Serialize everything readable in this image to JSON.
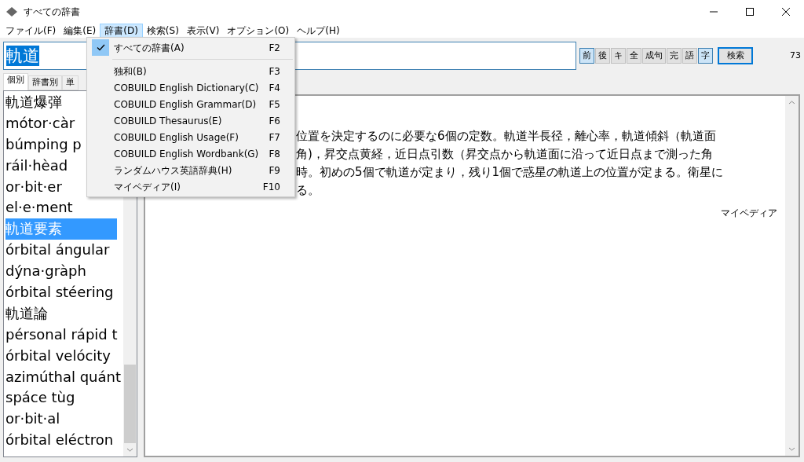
{
  "window": {
    "title": "すべての辞書"
  },
  "menubar": [
    {
      "label": "ファイル(F)",
      "selected": false
    },
    {
      "label": "編集(E)",
      "selected": false
    },
    {
      "label": "辞書(D)",
      "selected": true
    },
    {
      "label": "検索(S)",
      "selected": false
    },
    {
      "label": "表示(V)",
      "selected": false
    },
    {
      "label": "オプション(O)",
      "selected": false
    },
    {
      "label": "ヘルプ(H)",
      "selected": false
    }
  ],
  "search": {
    "value": "軌道"
  },
  "toggles": [
    {
      "label": "前",
      "selected": true
    },
    {
      "label": "後",
      "selected": false
    },
    {
      "label": "キ",
      "selected": false
    },
    {
      "label": "全",
      "selected": false
    },
    {
      "label": "成句",
      "selected": false
    },
    {
      "label": "完",
      "selected": false
    },
    {
      "label": "語",
      "selected": false
    },
    {
      "label": "字",
      "selected": true
    }
  ],
  "search_button": "検索",
  "count": "73",
  "tabs": [
    {
      "label": "個別",
      "selected": true
    },
    {
      "label": "辞書別",
      "selected": false
    },
    {
      "label": "単",
      "selected": false
    }
  ],
  "words": [
    {
      "text": "軌道爆弾",
      "selected": false
    },
    {
      "text": "mótor·càr",
      "selected": false
    },
    {
      "text": "búmping p",
      "selected": false
    },
    {
      "text": "ráil·hèad",
      "selected": false
    },
    {
      "text": "or·bit·er",
      "selected": false
    },
    {
      "text": "el·e·ment",
      "selected": false
    },
    {
      "text": "軌道要素",
      "selected": true
    },
    {
      "text": "órbital ángular",
      "selected": false
    },
    {
      "text": "dýna·gràph",
      "selected": false
    },
    {
      "text": "órbital stéering",
      "selected": false
    },
    {
      "text": "軌道論",
      "selected": false
    },
    {
      "text": "pérsonal rápid t",
      "selected": false
    },
    {
      "text": "órbital velócity",
      "selected": false
    },
    {
      "text": "azimúthal quánt",
      "selected": false
    },
    {
      "text": "spáce tùg",
      "selected": false
    },
    {
      "text": "or·bit·al",
      "selected": false
    },
    {
      "text": "órbital eléctron",
      "selected": false
    }
  ],
  "definition": {
    "lines": [
      "位置を決定するのに必要な6個の定数。軌道半長径，離心率，軌道傾斜（軌道面",
      "角)，昇交点黄経，近日点引数（昇交点から軌道面に沿って近日点まで測った角",
      "時。初めの5個で軌道が定まり，残り1個で惑星の軌道上の位置が定まる。衛星に",
      "る。"
    ],
    "source": "マイペディア"
  },
  "menu": [
    {
      "label": "すべての辞書(A)",
      "shortcut": "F2",
      "checked": true,
      "separator_after": true
    },
    {
      "label": "独和(B)",
      "shortcut": "F3",
      "checked": false,
      "separator_after": false
    },
    {
      "label": "COBUILD English Dictionary(C)",
      "shortcut": "F4",
      "checked": false,
      "separator_after": false
    },
    {
      "label": "COBUILD English Grammar(D)",
      "shortcut": "F5",
      "checked": false,
      "separator_after": false
    },
    {
      "label": "COBUILD Thesaurus(E)",
      "shortcut": "F6",
      "checked": false,
      "separator_after": false
    },
    {
      "label": "COBUILD English Usage(F)",
      "shortcut": "F7",
      "checked": false,
      "separator_after": false
    },
    {
      "label": "COBUILD English Wordbank(G)",
      "shortcut": "F8",
      "checked": false,
      "separator_after": false
    },
    {
      "label": "ランダムハウス英語辞典(H)",
      "shortcut": "F9",
      "checked": false,
      "separator_after": false
    },
    {
      "label": "マイペディア(I)",
      "shortcut": "F10",
      "checked": false,
      "separator_after": false
    }
  ]
}
